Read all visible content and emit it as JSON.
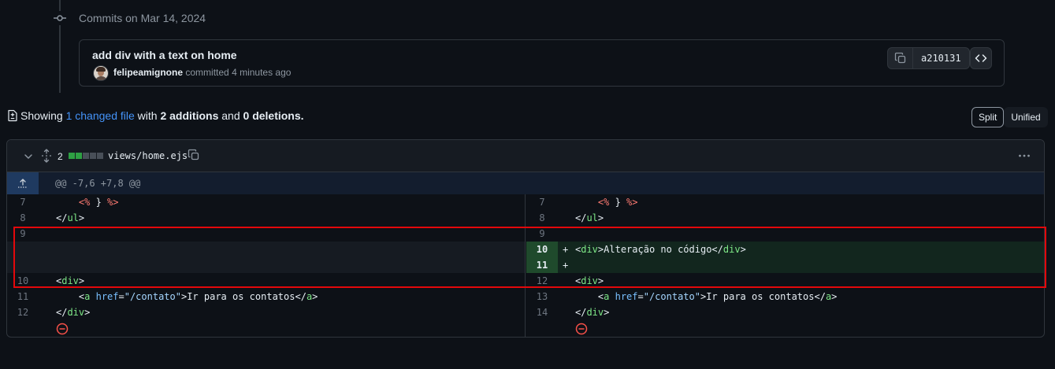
{
  "commits": {
    "heading": "Commits on Mar 14, 2024",
    "commit": {
      "title": "add div with a text on home",
      "author": "felipeamignone",
      "action": "committed",
      "time": "4 minutes ago",
      "sha": "a210131"
    }
  },
  "summary": {
    "prefix": "Showing",
    "changed_link": "1 changed file",
    "with": "with",
    "additions": "2 additions",
    "and": "and",
    "deletions": "0 deletions",
    "suffix": "."
  },
  "view_toggle": {
    "split": "Split",
    "unified": "Unified",
    "selected": "Split"
  },
  "file": {
    "change_count": "2",
    "diffstat": [
      "add",
      "add",
      "neutral",
      "neutral",
      "neutral"
    ],
    "filename": "views/home.ejs",
    "hunk_header": "@@ -7,6 +7,8 @@",
    "left_lines": [
      {
        "num": "7",
        "code": "    <% } %>"
      },
      {
        "num": "8",
        "code": "</ul>"
      },
      {
        "num": "9",
        "code": ""
      },
      {
        "num": "",
        "code": ""
      },
      {
        "num": "10",
        "code": "<div>"
      },
      {
        "num": "11",
        "code": "    <a href=\"/contato\">Ir para os contatos</a>"
      },
      {
        "num": "12",
        "code": "</div>"
      }
    ],
    "right_lines": [
      {
        "num": "7",
        "code": "    <% } %>"
      },
      {
        "num": "8",
        "code": "</ul>"
      },
      {
        "num": "9",
        "code": ""
      },
      {
        "num": "10",
        "code": "<div>Alteração no código</div>",
        "marker": "+"
      },
      {
        "num": "11",
        "code": "",
        "marker": "+"
      },
      {
        "num": "12",
        "code": "<div>"
      },
      {
        "num": "13",
        "code": "    <a href=\"/contato\">Ir para os contatos</a>"
      },
      {
        "num": "14",
        "code": "</div>"
      }
    ]
  },
  "colors": {
    "background": "#0d1117",
    "link": "#4493f8",
    "addition": "#2ea043",
    "highlight_box": "#e3080b"
  }
}
